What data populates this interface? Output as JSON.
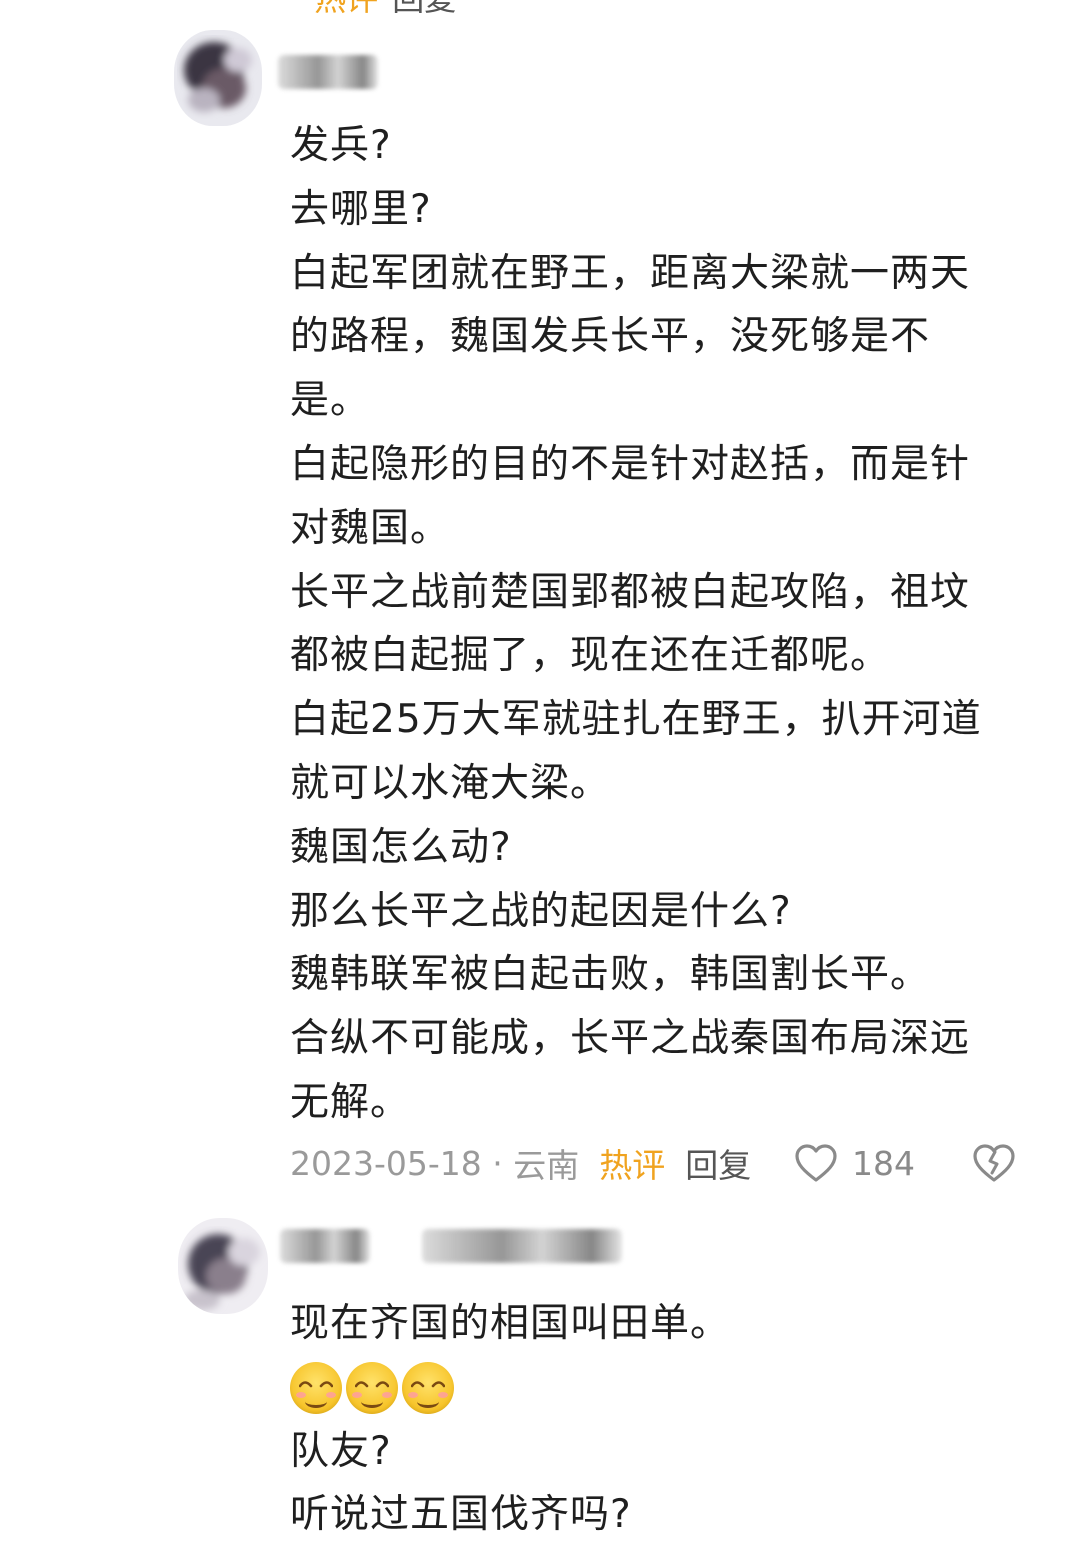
{
  "top_meta": {
    "hot_label": "热评",
    "reply_label": "回复"
  },
  "comments": [
    {
      "lines": [
        "发兵?",
        "去哪里?",
        "白起军团就在野王，距离大梁就一两天",
        "的路程，魏国发兵长平，没死够是不",
        "是。",
        "白起隐形的目的不是针对赵括，而是针",
        "对魏国。",
        "长平之战前楚国郢都被白起攻陷，祖坟",
        "都被白起掘了，现在还在迁都呢。",
        "白起25万大军就驻扎在野王，扒开河道",
        "就可以水淹大梁。",
        "魏国怎么动?",
        "那么长平之战的起因是什么?",
        "魏韩联军被白起击败，韩国割长平。",
        "合纵不可能成，长平之战秦国布局深远",
        "无解。"
      ],
      "date": "2023-05-18",
      "location": "云南",
      "hot_label": "热评",
      "reply_label": "回复",
      "likes": "184"
    },
    {
      "lines_before_emoji": [
        "现在齐国的相国叫田单。"
      ],
      "emoji_count": 3,
      "emoji_icon": "blushing-smile-emoji",
      "lines_after_emoji": [
        "队友?",
        "听说过五国伐齐吗?"
      ]
    }
  ],
  "colors": {
    "hot": "#f0a31f",
    "meta": "#9a9a9a",
    "text": "#1f1f1f"
  }
}
